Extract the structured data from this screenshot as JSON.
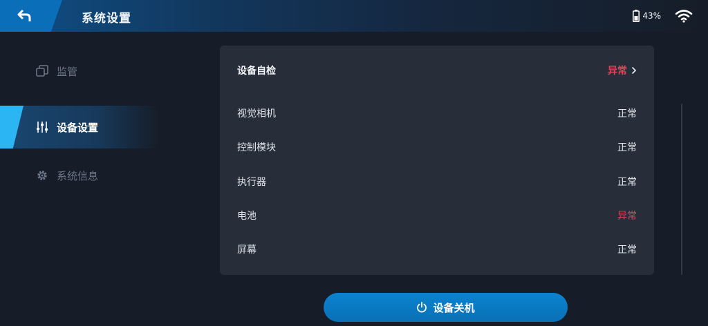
{
  "header": {
    "title": "系统设置",
    "battery_text": "43%",
    "icons": {
      "back": "back-icon",
      "battery": "battery-icon",
      "wifi": "wifi-icon"
    }
  },
  "sidebar": {
    "items": [
      {
        "label": "监管",
        "icon": "layers-icon",
        "active": false
      },
      {
        "label": "设备设置",
        "icon": "sliders-icon",
        "active": true
      },
      {
        "label": "系统信息",
        "icon": "gear-icon",
        "active": false
      }
    ]
  },
  "panel": {
    "self_check": {
      "label": "设备自检",
      "value": "异常"
    },
    "rows": [
      {
        "label": "视觉相机",
        "value": "正常"
      },
      {
        "label": "控制模块",
        "value": "正常"
      },
      {
        "label": "执行器",
        "value": "正常"
      },
      {
        "label": "电池",
        "value": "异常"
      },
      {
        "label": "屏幕",
        "value": "正常"
      }
    ]
  },
  "shutdown": {
    "label": "设备关机",
    "icon": "power-icon"
  },
  "colors": {
    "accent": "#0a70b6",
    "error": "#e0425a",
    "active_tab": "#2bb6f3",
    "background": "#161d28",
    "panel": "#272e39"
  }
}
